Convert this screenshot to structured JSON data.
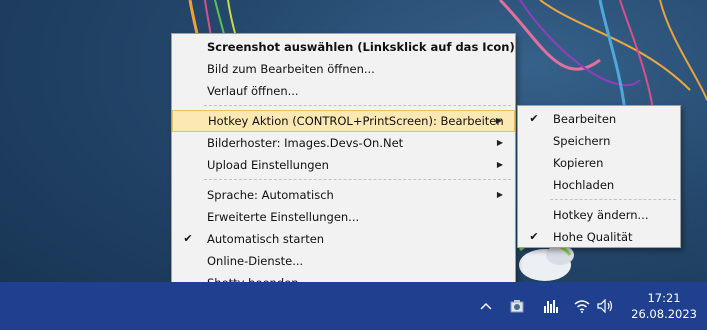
{
  "main_menu": {
    "items": [
      {
        "label": "Screenshot auswählen (Linksklick auf das Icon)",
        "bold": true
      },
      {
        "label": "Bild zum Bearbeiten öffnen..."
      },
      {
        "label": "Verlauf öffnen..."
      },
      {
        "separator": true
      },
      {
        "label": "Hotkey Aktion (CONTROL+PrintScreen): Bearbeiten",
        "submenu": true,
        "highlighted": true
      },
      {
        "label": "Bilderhoster: Images.Devs-On.Net",
        "submenu": true
      },
      {
        "label": "Upload Einstellungen",
        "submenu": true
      },
      {
        "separator": true
      },
      {
        "label": "Sprache: Automatisch",
        "submenu": true
      },
      {
        "label": "Erweiterte Einstellungen..."
      },
      {
        "label": "Automatisch starten",
        "checked": true
      },
      {
        "label": "Online-Dienste..."
      },
      {
        "label": "Shotty beenden"
      }
    ]
  },
  "sub_menu": {
    "items": [
      {
        "label": "Bearbeiten",
        "checked": true
      },
      {
        "label": "Speichern"
      },
      {
        "label": "Kopieren"
      },
      {
        "label": "Hochladen"
      },
      {
        "separator": true
      },
      {
        "label": "Hotkey ändern..."
      },
      {
        "label": "Hohe Qualität",
        "checked": true
      }
    ]
  },
  "check_glyph": "✔",
  "arrow_glyph": "▶",
  "taskbar": {
    "color": "#1f3f8f",
    "chevron": "^",
    "tray_icons": [
      "show-hidden-icons-icon",
      "shotty-tray-icon",
      "equalizer-tray-icon",
      "wifi-icon",
      "volume-icon"
    ],
    "time": "17:21",
    "date": "26.08.2023"
  }
}
